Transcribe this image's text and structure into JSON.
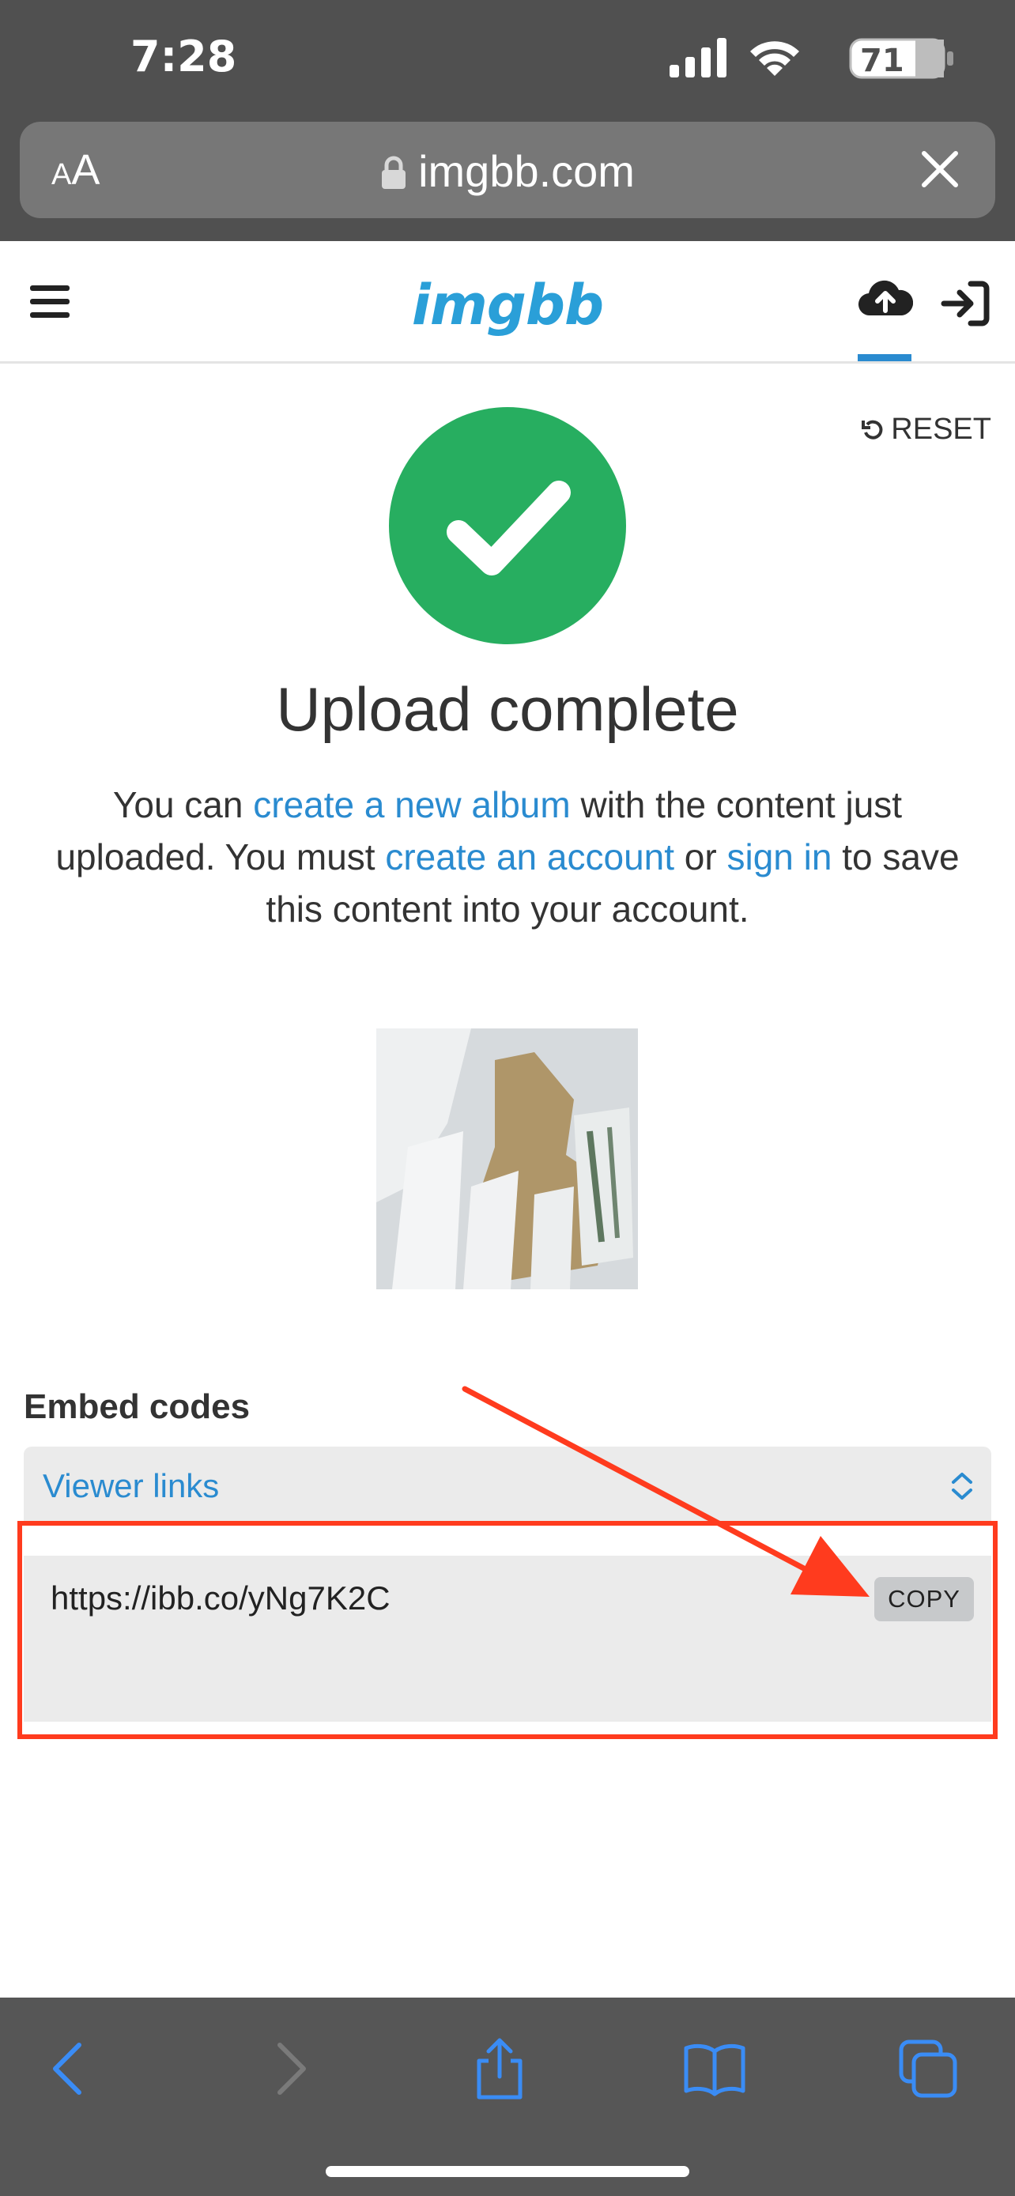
{
  "status_bar": {
    "time": "7:28",
    "battery": "71"
  },
  "browser": {
    "text_size_small": "A",
    "text_size_large": "A",
    "url": "imgbb.com"
  },
  "header": {
    "logo": "imgbb"
  },
  "main": {
    "reset_label": "RESET",
    "title": "Upload complete",
    "message": {
      "part1": "You can ",
      "link_album": "create a new album",
      "part2": " with the content just uploaded. You must ",
      "link_account": "create an account",
      "part3": " or ",
      "link_signin": "sign in",
      "part4": " to save this content into your account."
    },
    "embed_label": "Embed codes",
    "viewer_select_value": "Viewer links",
    "embed_url": "https://ibb.co/yNg7K2C",
    "copy_label": "COPY"
  },
  "colors": {
    "accent": "#2a8bd0",
    "success": "#27ae60",
    "annotation": "#ff3b1e",
    "chrome": "#505050"
  },
  "icons": [
    "signal-icon",
    "wifi-icon",
    "battery-icon",
    "lock-icon",
    "close-icon",
    "menu-icon",
    "cloud-upload-icon",
    "sign-in-icon",
    "reset-icon",
    "checkmark-icon",
    "chevron-updown-icon",
    "back-icon",
    "forward-icon",
    "share-icon",
    "bookmarks-icon",
    "tabs-icon"
  ]
}
